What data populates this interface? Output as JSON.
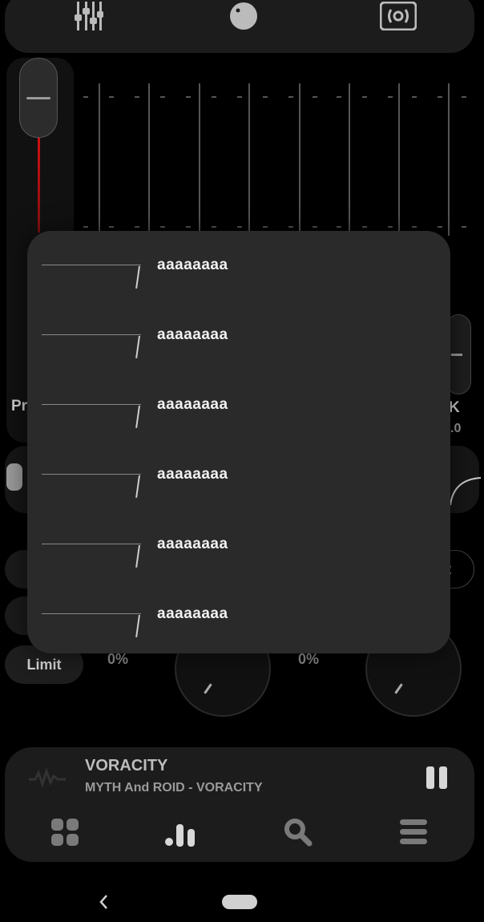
{
  "eq": {
    "preamp_label": "Pr",
    "right_label": "K",
    "right_value": ".0"
  },
  "controls": {
    "limit_label": "Limit",
    "pct_left": "0%",
    "pct_right": "0%",
    "right_button_partial": "t"
  },
  "dialog": {
    "items": [
      {
        "label": "aaaaaaaa"
      },
      {
        "label": "aaaaaaaa"
      },
      {
        "label": "aaaaaaaa"
      },
      {
        "label": "aaaaaaaa"
      },
      {
        "label": "aaaaaaaa"
      },
      {
        "label": "aaaaaaaa"
      }
    ]
  },
  "player": {
    "title": "VORACITY",
    "subtitle": "MYTH And ROID - VORACITY"
  },
  "colors": {
    "background": "#000000",
    "panel": "#1c1c1c",
    "dialog": "#2a2a2a",
    "preamp_accent": "#d01010"
  },
  "icons": {
    "top": [
      "equalizer-sliders-icon",
      "knob-icon",
      "speaker-surround-icon"
    ],
    "bottom_nav": [
      "grid-icon",
      "bars-chart-icon",
      "search-icon",
      "menu-icon"
    ]
  }
}
